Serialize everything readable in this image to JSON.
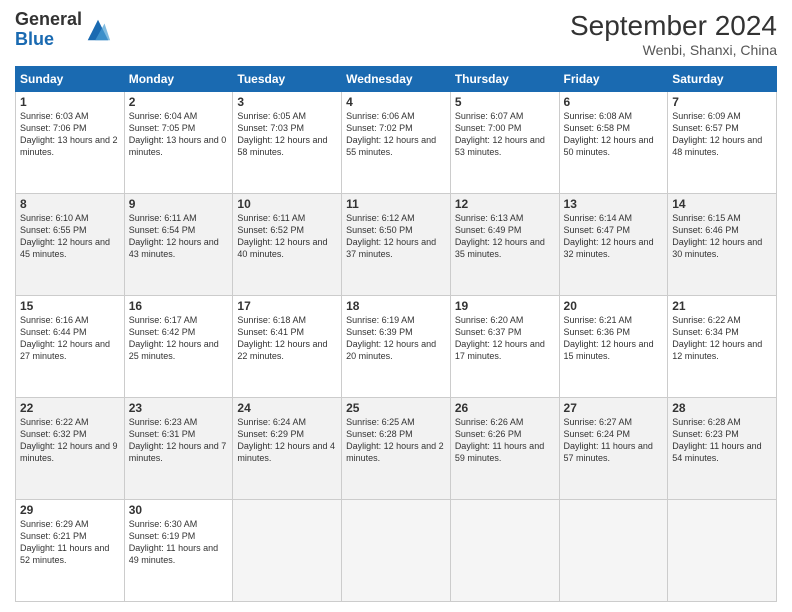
{
  "header": {
    "logo_line1": "General",
    "logo_line2": "Blue",
    "month_title": "September 2024",
    "location": "Wenbi, Shanxi, China"
  },
  "weekdays": [
    "Sunday",
    "Monday",
    "Tuesday",
    "Wednesday",
    "Thursday",
    "Friday",
    "Saturday"
  ],
  "weeks": [
    [
      {
        "day": "1",
        "sunrise": "Sunrise: 6:03 AM",
        "sunset": "Sunset: 7:06 PM",
        "daylight": "Daylight: 13 hours and 2 minutes."
      },
      {
        "day": "2",
        "sunrise": "Sunrise: 6:04 AM",
        "sunset": "Sunset: 7:05 PM",
        "daylight": "Daylight: 13 hours and 0 minutes."
      },
      {
        "day": "3",
        "sunrise": "Sunrise: 6:05 AM",
        "sunset": "Sunset: 7:03 PM",
        "daylight": "Daylight: 12 hours and 58 minutes."
      },
      {
        "day": "4",
        "sunrise": "Sunrise: 6:06 AM",
        "sunset": "Sunset: 7:02 PM",
        "daylight": "Daylight: 12 hours and 55 minutes."
      },
      {
        "day": "5",
        "sunrise": "Sunrise: 6:07 AM",
        "sunset": "Sunset: 7:00 PM",
        "daylight": "Daylight: 12 hours and 53 minutes."
      },
      {
        "day": "6",
        "sunrise": "Sunrise: 6:08 AM",
        "sunset": "Sunset: 6:58 PM",
        "daylight": "Daylight: 12 hours and 50 minutes."
      },
      {
        "day": "7",
        "sunrise": "Sunrise: 6:09 AM",
        "sunset": "Sunset: 6:57 PM",
        "daylight": "Daylight: 12 hours and 48 minutes."
      }
    ],
    [
      {
        "day": "8",
        "sunrise": "Sunrise: 6:10 AM",
        "sunset": "Sunset: 6:55 PM",
        "daylight": "Daylight: 12 hours and 45 minutes."
      },
      {
        "day": "9",
        "sunrise": "Sunrise: 6:11 AM",
        "sunset": "Sunset: 6:54 PM",
        "daylight": "Daylight: 12 hours and 43 minutes."
      },
      {
        "day": "10",
        "sunrise": "Sunrise: 6:11 AM",
        "sunset": "Sunset: 6:52 PM",
        "daylight": "Daylight: 12 hours and 40 minutes."
      },
      {
        "day": "11",
        "sunrise": "Sunrise: 6:12 AM",
        "sunset": "Sunset: 6:50 PM",
        "daylight": "Daylight: 12 hours and 37 minutes."
      },
      {
        "day": "12",
        "sunrise": "Sunrise: 6:13 AM",
        "sunset": "Sunset: 6:49 PM",
        "daylight": "Daylight: 12 hours and 35 minutes."
      },
      {
        "day": "13",
        "sunrise": "Sunrise: 6:14 AM",
        "sunset": "Sunset: 6:47 PM",
        "daylight": "Daylight: 12 hours and 32 minutes."
      },
      {
        "day": "14",
        "sunrise": "Sunrise: 6:15 AM",
        "sunset": "Sunset: 6:46 PM",
        "daylight": "Daylight: 12 hours and 30 minutes."
      }
    ],
    [
      {
        "day": "15",
        "sunrise": "Sunrise: 6:16 AM",
        "sunset": "Sunset: 6:44 PM",
        "daylight": "Daylight: 12 hours and 27 minutes."
      },
      {
        "day": "16",
        "sunrise": "Sunrise: 6:17 AM",
        "sunset": "Sunset: 6:42 PM",
        "daylight": "Daylight: 12 hours and 25 minutes."
      },
      {
        "day": "17",
        "sunrise": "Sunrise: 6:18 AM",
        "sunset": "Sunset: 6:41 PM",
        "daylight": "Daylight: 12 hours and 22 minutes."
      },
      {
        "day": "18",
        "sunrise": "Sunrise: 6:19 AM",
        "sunset": "Sunset: 6:39 PM",
        "daylight": "Daylight: 12 hours and 20 minutes."
      },
      {
        "day": "19",
        "sunrise": "Sunrise: 6:20 AM",
        "sunset": "Sunset: 6:37 PM",
        "daylight": "Daylight: 12 hours and 17 minutes."
      },
      {
        "day": "20",
        "sunrise": "Sunrise: 6:21 AM",
        "sunset": "Sunset: 6:36 PM",
        "daylight": "Daylight: 12 hours and 15 minutes."
      },
      {
        "day": "21",
        "sunrise": "Sunrise: 6:22 AM",
        "sunset": "Sunset: 6:34 PM",
        "daylight": "Daylight: 12 hours and 12 minutes."
      }
    ],
    [
      {
        "day": "22",
        "sunrise": "Sunrise: 6:22 AM",
        "sunset": "Sunset: 6:32 PM",
        "daylight": "Daylight: 12 hours and 9 minutes."
      },
      {
        "day": "23",
        "sunrise": "Sunrise: 6:23 AM",
        "sunset": "Sunset: 6:31 PM",
        "daylight": "Daylight: 12 hours and 7 minutes."
      },
      {
        "day": "24",
        "sunrise": "Sunrise: 6:24 AM",
        "sunset": "Sunset: 6:29 PM",
        "daylight": "Daylight: 12 hours and 4 minutes."
      },
      {
        "day": "25",
        "sunrise": "Sunrise: 6:25 AM",
        "sunset": "Sunset: 6:28 PM",
        "daylight": "Daylight: 12 hours and 2 minutes."
      },
      {
        "day": "26",
        "sunrise": "Sunrise: 6:26 AM",
        "sunset": "Sunset: 6:26 PM",
        "daylight": "Daylight: 11 hours and 59 minutes."
      },
      {
        "day": "27",
        "sunrise": "Sunrise: 6:27 AM",
        "sunset": "Sunset: 6:24 PM",
        "daylight": "Daylight: 11 hours and 57 minutes."
      },
      {
        "day": "28",
        "sunrise": "Sunrise: 6:28 AM",
        "sunset": "Sunset: 6:23 PM",
        "daylight": "Daylight: 11 hours and 54 minutes."
      }
    ],
    [
      {
        "day": "29",
        "sunrise": "Sunrise: 6:29 AM",
        "sunset": "Sunset: 6:21 PM",
        "daylight": "Daylight: 11 hours and 52 minutes."
      },
      {
        "day": "30",
        "sunrise": "Sunrise: 6:30 AM",
        "sunset": "Sunset: 6:19 PM",
        "daylight": "Daylight: 11 hours and 49 minutes."
      },
      null,
      null,
      null,
      null,
      null
    ]
  ]
}
